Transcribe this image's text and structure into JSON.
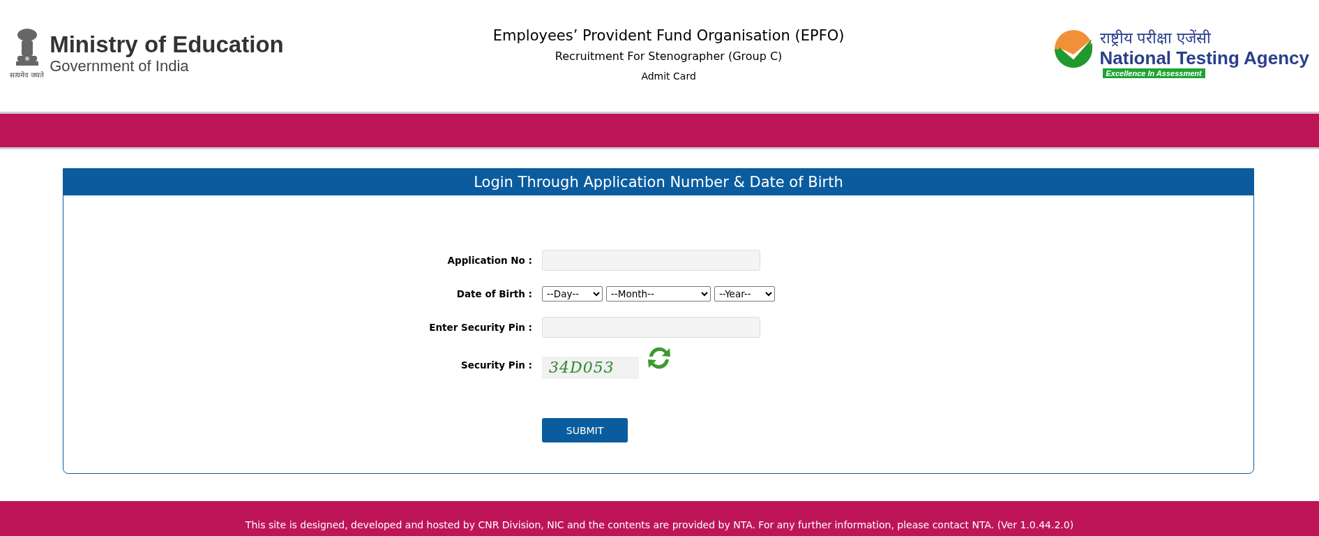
{
  "header": {
    "ministry": {
      "title": "Ministry of Education",
      "subtitle": "Government of India",
      "motto": "सत्यमेव जयते"
    },
    "center": {
      "organisation": "Employees’ Provident Fund Organisation (EPFO)",
      "recruitment": "Recruitment For Stenographer (Group C)",
      "page": "Admit Card"
    },
    "agency": {
      "hindi": "राष्ट्रीय परीक्षा एजेंसी",
      "name": "National Testing Agency",
      "tagline": "Excellence In Assessment"
    }
  },
  "login": {
    "title": "Login Through Application Number & Date of Birth",
    "fields": [
      {
        "kind": "text",
        "label": "Application No :"
      },
      {
        "kind": "date",
        "label": "Date of Birth :",
        "selects": [
          "--Day--",
          "--Month--",
          "--Year--"
        ]
      },
      {
        "kind": "text",
        "label": "Enter Security Pin :"
      },
      {
        "kind": "captcha",
        "label": "Security Pin :",
        "code": "34D053"
      }
    ],
    "submit": "SUBMIT"
  },
  "footer": "This site is designed, developed and hosted by CNR Division, NIC and the contents are provided by NTA. For any further information, please contact NTA. (Ver 1.0.44.2.0)"
}
